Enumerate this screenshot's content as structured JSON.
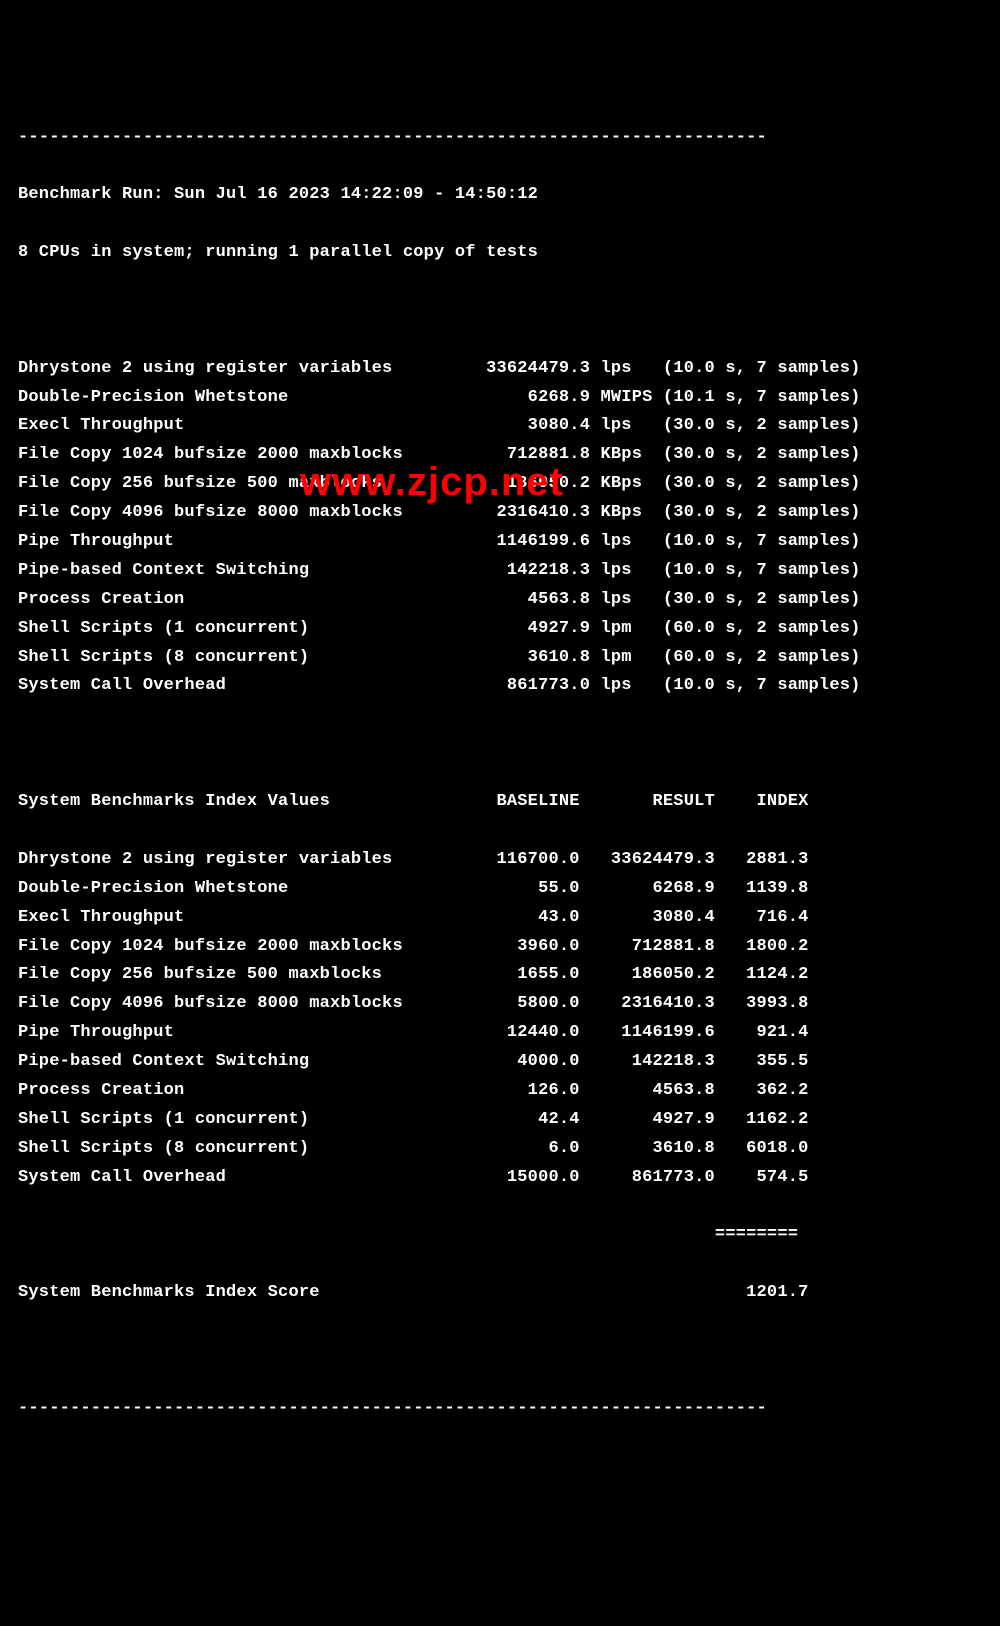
{
  "separator_top": "------------------------------------------------------------------------",
  "header": {
    "run_line": "Benchmark Run: Sun Jul 16 2023 14:22:09 - 14:50:12",
    "cpu_line": "8 CPUs in system; running 1 parallel copy of tests"
  },
  "tests": [
    {
      "name": "Dhrystone 2 using register variables",
      "value": "33624479.3",
      "unit": "lps",
      "timing": "(10.0 s, 7 samples)"
    },
    {
      "name": "Double-Precision Whetstone",
      "value": "6268.9",
      "unit": "MWIPS",
      "timing": "(10.1 s, 7 samples)"
    },
    {
      "name": "Execl Throughput",
      "value": "3080.4",
      "unit": "lps",
      "timing": "(30.0 s, 2 samples)"
    },
    {
      "name": "File Copy 1024 bufsize 2000 maxblocks",
      "value": "712881.8",
      "unit": "KBps",
      "timing": "(30.0 s, 2 samples)"
    },
    {
      "name": "File Copy 256 bufsize 500 maxblocks",
      "value": "186050.2",
      "unit": "KBps",
      "timing": "(30.0 s, 2 samples)"
    },
    {
      "name": "File Copy 4096 bufsize 8000 maxblocks",
      "value": "2316410.3",
      "unit": "KBps",
      "timing": "(30.0 s, 2 samples)"
    },
    {
      "name": "Pipe Throughput",
      "value": "1146199.6",
      "unit": "lps",
      "timing": "(10.0 s, 7 samples)"
    },
    {
      "name": "Pipe-based Context Switching",
      "value": "142218.3",
      "unit": "lps",
      "timing": "(10.0 s, 7 samples)"
    },
    {
      "name": "Process Creation",
      "value": "4563.8",
      "unit": "lps",
      "timing": "(30.0 s, 2 samples)"
    },
    {
      "name": "Shell Scripts (1 concurrent)",
      "value": "4927.9",
      "unit": "lpm",
      "timing": "(60.0 s, 2 samples)"
    },
    {
      "name": "Shell Scripts (8 concurrent)",
      "value": "3610.8",
      "unit": "lpm",
      "timing": "(60.0 s, 2 samples)"
    },
    {
      "name": "System Call Overhead",
      "value": "861773.0",
      "unit": "lps",
      "timing": "(10.0 s, 7 samples)"
    }
  ],
  "index_header": {
    "label": "System Benchmarks Index Values",
    "col1": "BASELINE",
    "col2": "RESULT",
    "col3": "INDEX"
  },
  "index_rows": [
    {
      "name": "Dhrystone 2 using register variables",
      "baseline": "116700.0",
      "result": "33624479.3",
      "index": "2881.3"
    },
    {
      "name": "Double-Precision Whetstone",
      "baseline": "55.0",
      "result": "6268.9",
      "index": "1139.8"
    },
    {
      "name": "Execl Throughput",
      "baseline": "43.0",
      "result": "3080.4",
      "index": "716.4"
    },
    {
      "name": "File Copy 1024 bufsize 2000 maxblocks",
      "baseline": "3960.0",
      "result": "712881.8",
      "index": "1800.2"
    },
    {
      "name": "File Copy 256 bufsize 500 maxblocks",
      "baseline": "1655.0",
      "result": "186050.2",
      "index": "1124.2"
    },
    {
      "name": "File Copy 4096 bufsize 8000 maxblocks",
      "baseline": "5800.0",
      "result": "2316410.3",
      "index": "3993.8"
    },
    {
      "name": "Pipe Throughput",
      "baseline": "12440.0",
      "result": "1146199.6",
      "index": "921.4"
    },
    {
      "name": "Pipe-based Context Switching",
      "baseline": "4000.0",
      "result": "142218.3",
      "index": "355.5"
    },
    {
      "name": "Process Creation",
      "baseline": "126.0",
      "result": "4563.8",
      "index": "362.2"
    },
    {
      "name": "Shell Scripts (1 concurrent)",
      "baseline": "42.4",
      "result": "4927.9",
      "index": "1162.2"
    },
    {
      "name": "Shell Scripts (8 concurrent)",
      "baseline": "6.0",
      "result": "3610.8",
      "index": "6018.0"
    },
    {
      "name": "System Call Overhead",
      "baseline": "15000.0",
      "result": "861773.0",
      "index": "574.5"
    }
  ],
  "score_separator": "                                                                   ========",
  "score": {
    "label": "System Benchmarks Index Score",
    "value": "1201.7"
  },
  "separator_bottom": "------------------------------------------------------------------------",
  "watermark": "www.zjcp.net"
}
